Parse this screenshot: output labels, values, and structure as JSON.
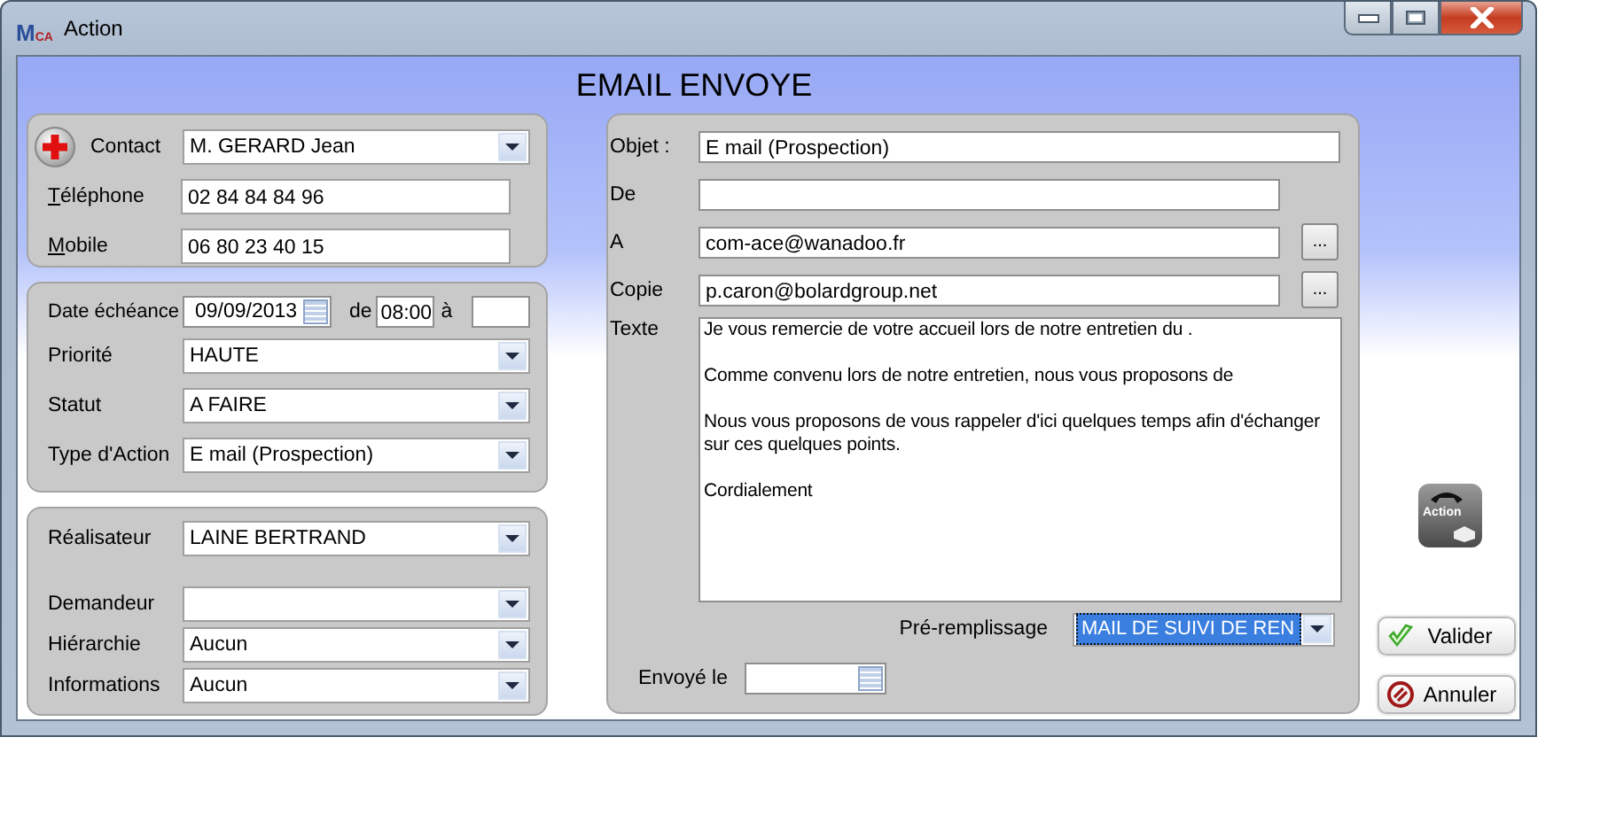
{
  "window": {
    "title": "Action",
    "logo_text": [
      "M",
      "CA"
    ]
  },
  "heading": "EMAIL ENVOYE",
  "contact": [
    {
      "label": "Contact",
      "kind": "combo",
      "value": "M. GERARD Jean",
      "access_key": false
    },
    {
      "label": "Téléphone",
      "kind": "text",
      "value": "02 84 84 84 96",
      "access_key": true
    },
    {
      "label": "Mobile",
      "kind": "text",
      "value": "06 80 23 40 15",
      "access_key": true
    }
  ],
  "schedule": {
    "date_label": "Date échéance",
    "date": "09/09/2013",
    "from_label": "de",
    "from_time": "08:00",
    "to_label": "à",
    "fields": [
      {
        "label": "Priorité",
        "value": "HAUTE"
      },
      {
        "label": "Statut",
        "value": "A FAIRE"
      },
      {
        "label": "Type d'Action",
        "value": "E mail (Prospection)"
      }
    ]
  },
  "people": [
    {
      "label": "Réalisateur",
      "value": "LAINE BERTRAND"
    },
    {
      "label": "Demandeur"
    },
    {
      "label": "Hiérarchie",
      "value": "Aucun"
    },
    {
      "label": "Informations",
      "value": "Aucun"
    }
  ],
  "email": {
    "fields": [
      {
        "label": "Objet :",
        "value": "E mail (Prospection)",
        "kind": "wide"
      },
      {
        "label": "De",
        "kind": "plain"
      },
      {
        "label": "A",
        "value": "com-ace@wanadoo.fr",
        "kind": "browse",
        "button": "..."
      },
      {
        "label": "Copie",
        "value": "p.caron@bolardgroup.net",
        "kind": "browse",
        "button": "..."
      }
    ],
    "body_label": "Texte",
    "body": [
      [
        "Je vous remercie de votre accueil lors de notre entretien du ."
      ],
      [
        "Comme convenu lors de notre entretien, nous vous proposons de"
      ],
      [
        "Nous vous proposons de vous rappeler d'ici quelques temps afin d'échanger",
        "sur ces quelques points."
      ],
      [
        "Cordialement"
      ]
    ],
    "prefill_label": "Pré-remplissage",
    "prefill_value": "MAIL DE SUIVI DE REN",
    "prefill_selected": true,
    "sent_label": "Envoyé le"
  },
  "action_logo": "Action",
  "buttons": [
    {
      "label": "Valider",
      "kind": "ok"
    },
    {
      "label": "Annuler",
      "kind": "cancel"
    }
  ]
}
